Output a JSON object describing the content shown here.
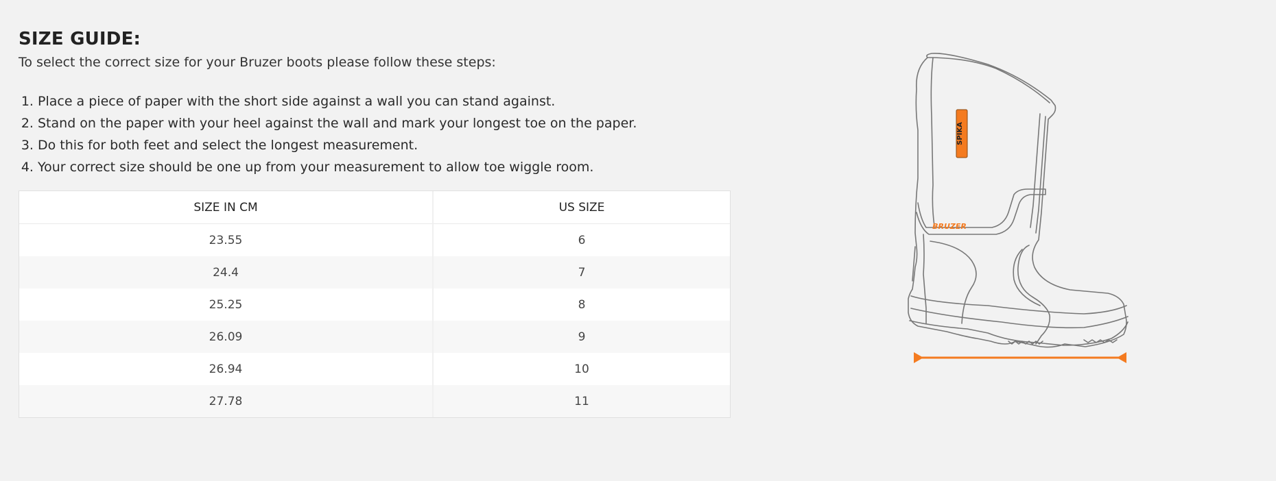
{
  "heading": "SIZE GUIDE:",
  "intro": "To select the correct size for your Bruzer boots please follow these steps:",
  "steps": [
    "Place a piece of paper with the short side against a wall you can stand against.",
    "Stand on the paper with your heel against the wall and mark your longest toe on the paper.",
    "Do this for both feet and select the longest measurement.",
    "Your correct size should be one up from your measurement to allow toe wiggle room."
  ],
  "table": {
    "headers": [
      "SIZE IN CM",
      "US SIZE"
    ],
    "rows": [
      [
        "23.55",
        "6"
      ],
      [
        "24.4",
        "7"
      ],
      [
        "25.25",
        "8"
      ],
      [
        "26.09",
        "9"
      ],
      [
        "26.94",
        "10"
      ],
      [
        "27.78",
        "11"
      ]
    ]
  },
  "illustration": {
    "tab_logo": "SPIKA",
    "band_logo": "BRUZER",
    "accent_color": "#f47b20",
    "line_color": "#777777"
  }
}
